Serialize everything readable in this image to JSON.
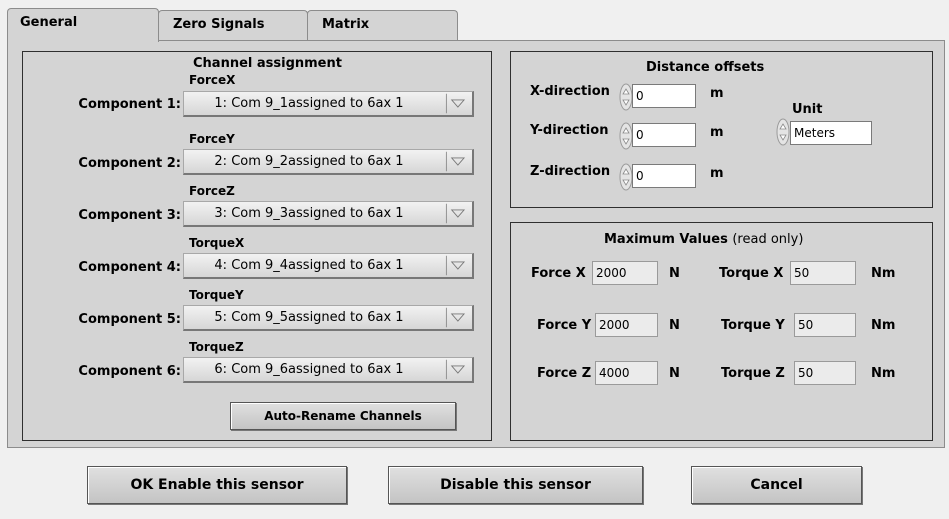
{
  "tabs": [
    {
      "label": "General"
    },
    {
      "label": "Zero Signals"
    },
    {
      "label": "Matrix"
    }
  ],
  "channel_assignment": {
    "title": "Channel assignment",
    "components": [
      {
        "label": "Component 1:",
        "name": "ForceX",
        "value": "1: Com 9_1assigned to 6ax 1"
      },
      {
        "label": "Component 2:",
        "name": "ForceY",
        "value": "2: Com 9_2assigned to 6ax 1"
      },
      {
        "label": "Component 3:",
        "name": "ForceZ",
        "value": "3: Com 9_3assigned to 6ax 1"
      },
      {
        "label": "Component 4:",
        "name": "TorqueX",
        "value": "4: Com 9_4assigned to 6ax 1"
      },
      {
        "label": "Component 5:",
        "name": "TorqueY",
        "value": "5: Com 9_5assigned to 6ax 1"
      },
      {
        "label": "Component 6:",
        "name": "TorqueZ",
        "value": "6: Com 9_6assigned to 6ax 1"
      }
    ],
    "auto_rename_label": "Auto-Rename Channels"
  },
  "distance_offsets": {
    "title": "Distance offsets",
    "rows": [
      {
        "label": "X-direction",
        "value": "0",
        "unit": "m"
      },
      {
        "label": "Y-direction",
        "value": "0",
        "unit": "m"
      },
      {
        "label": "Z-direction",
        "value": "0",
        "unit": "m"
      }
    ],
    "unit_label": "Unit",
    "unit_value": "Meters"
  },
  "max_values": {
    "title": "Maximum Values",
    "subtitle": "(read only)",
    "forces": [
      {
        "label": "Force X",
        "value": "2000",
        "unit": "N"
      },
      {
        "label": "Force Y",
        "value": "2000",
        "unit": "N"
      },
      {
        "label": "Force Z",
        "value": "4000",
        "unit": "N"
      }
    ],
    "torques": [
      {
        "label": "Torque X",
        "value": "50",
        "unit": "Nm"
      },
      {
        "label": "Torque Y",
        "value": "50",
        "unit": "Nm"
      },
      {
        "label": "Torque Z",
        "value": "50",
        "unit": "Nm"
      }
    ]
  },
  "buttons": {
    "ok": "OK Enable this sensor",
    "disable": "Disable this sensor",
    "cancel": "Cancel"
  }
}
